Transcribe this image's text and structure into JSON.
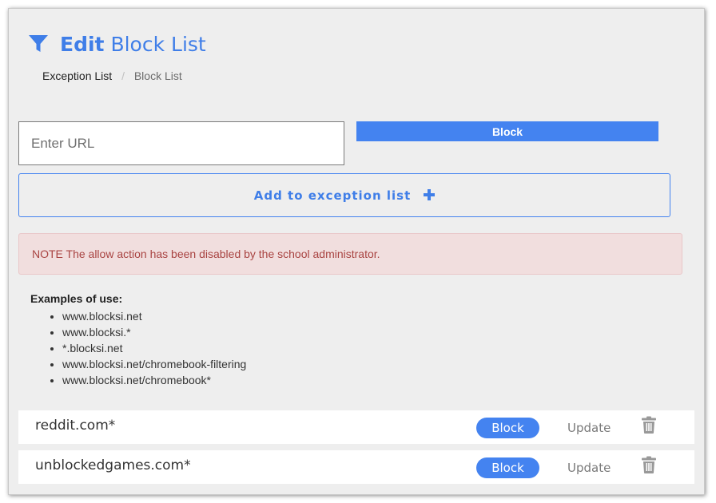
{
  "header": {
    "icon": "filter-icon",
    "title_bold": "Edit",
    "title_rest": "Block List"
  },
  "breadcrumb": {
    "items": [
      "Exception List",
      "Block List"
    ],
    "separator": "/"
  },
  "form": {
    "url_placeholder": "Enter URL",
    "url_value": "",
    "block_label": "Block",
    "add_label": "Add to exception list",
    "add_icon": "plus-icon"
  },
  "note": {
    "text": "NOTE The allow action has been disabled by the school administrator."
  },
  "examples": {
    "title": "Examples of use:",
    "items": [
      "www.blocksi.net",
      "www.blocksi.*",
      "*.blocksi.net",
      "www.blocksi.net/chromebook-filtering",
      "www.blocksi.net/chromebook*"
    ]
  },
  "entries": [
    {
      "domain": "reddit.com*",
      "action_label": "Block",
      "update_label": "Update",
      "delete_icon": "trash-icon"
    },
    {
      "domain": "unblockedgames.com*",
      "action_label": "Block",
      "update_label": "Update",
      "delete_icon": "trash-icon"
    }
  ],
  "colors": {
    "accent": "#4483f0",
    "title": "#3f7ee8",
    "panel_bg": "#eeeeee",
    "note_bg": "#f1dede",
    "note_text": "#a94442"
  }
}
